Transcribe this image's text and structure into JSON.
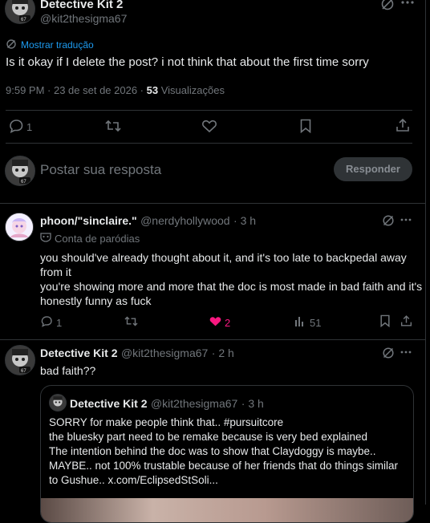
{
  "main_post": {
    "display_name": "Detective Kit 2",
    "handle": "@kit2thesigma67",
    "translate_label": "Mostrar tradução",
    "text": "Is it okay if I delete the post? i not think that about the first time sorry",
    "time": "9:59 PM · 23 de set de 2026 ·",
    "views_count": "53",
    "views_label": "Visualizações",
    "reply_count": "1"
  },
  "composer": {
    "placeholder": "Postar sua resposta",
    "button_label": "Responder"
  },
  "replies": [
    {
      "display_name": "phoon/\"sinclaire.\"",
      "handle": "@nerdyhollywood",
      "time": "· 3 h",
      "badge_label": "Conta de paródias",
      "text_lines": [
        "you should've already thought about it, and it's too late to backpedal away",
        "from it",
        "you're showing more and more that the doc is most made in bad faith and it's",
        "honestly funny as fuck"
      ],
      "reply_count": "1",
      "like_count": "2",
      "views_count": "51"
    },
    {
      "display_name": "Detective Kit 2",
      "handle": "@kit2thesigma67",
      "time": "· 2 h",
      "text": "bad faith??"
    }
  ],
  "quoted_post": {
    "display_name": "Detective Kit 2",
    "handle": "@kit2thesigma67",
    "time": "· 3 h",
    "text_lines": [
      "SORRY for make people think that.. #pursuitcore",
      "the bluesky part need to be remake because is very bed explained",
      "The intention behind the doc was to show that Claydoggy is maybe..",
      "MAYBE.. not 100% trustable because of her friends that do things similar",
      "to Gushue..  x.com/EclipsedStSoli..."
    ]
  },
  "colors": {
    "background": "#000000",
    "text": "#e7e9ea",
    "muted": "#71767b",
    "divider": "#2f3336",
    "like": "#f91880",
    "link": "#1d9bf0"
  }
}
